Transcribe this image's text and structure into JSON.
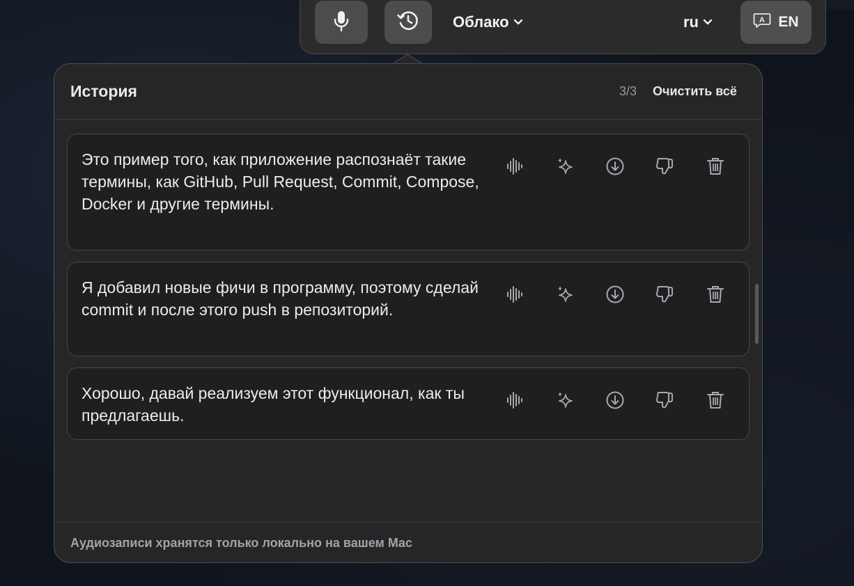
{
  "toolbar": {
    "provider_label": "Облако",
    "language_label": "ru",
    "output_lang_label": "EN"
  },
  "history": {
    "title": "История",
    "count": "3/3",
    "clear_all_label": "Очистить всё",
    "items": [
      {
        "text": "Это пример того, как приложение распознаёт такие термины, как GitHub, Pull Request, Commit, Compose, Docker и другие термины."
      },
      {
        "text": "Я добавил новые фичи в программу, поэтому сделай commit и после этого push в репозиторий."
      },
      {
        "text": "Хорошо, давай реализуем этот функционал, как ты предлагаешь."
      }
    ],
    "footer_note": "Аудиозаписи хранятся только локально на вашем Mac"
  },
  "icons": {
    "toolbar": [
      "microphone-icon",
      "history-clock-icon",
      "chevron-down-icon",
      "translate-bubble-icon"
    ],
    "item_actions": [
      "waveform-icon",
      "sparkles-icon",
      "download-icon",
      "thumbs-down-icon",
      "trash-icon"
    ]
  },
  "colors": {
    "panel": "#262628",
    "card": "#1f1f21",
    "button": "#4c4c4f",
    "text": "#ececee",
    "muted": "#9a9a9e",
    "icon": "#a9a9ad"
  }
}
